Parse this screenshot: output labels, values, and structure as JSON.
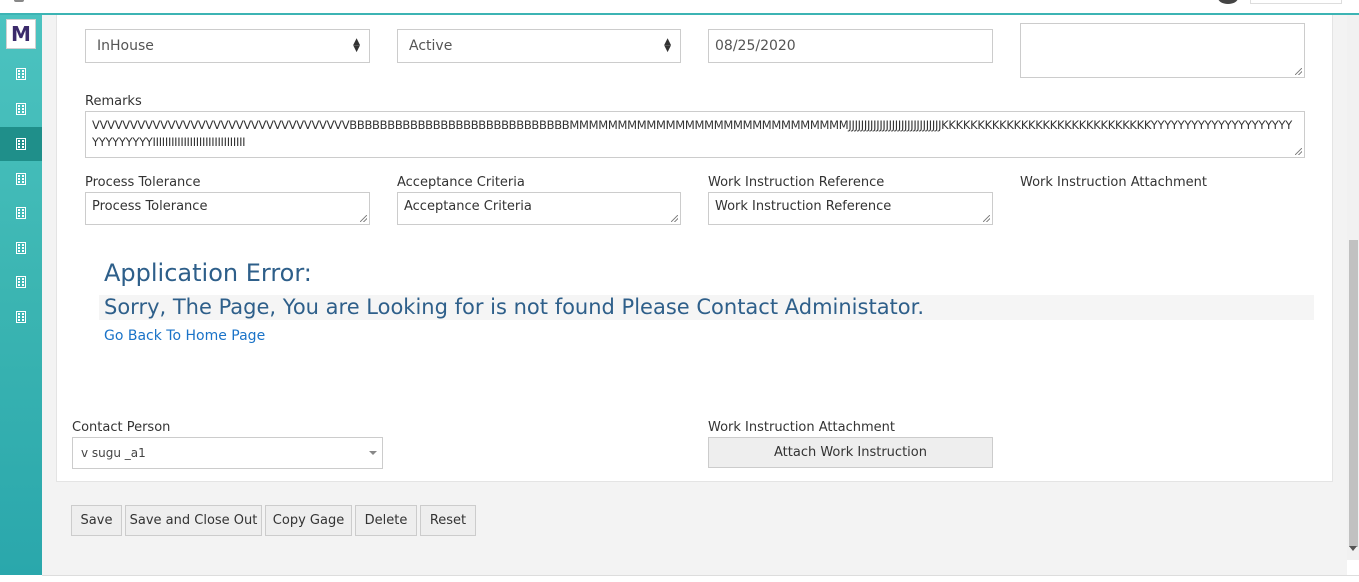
{
  "form": {
    "calibration_source": {
      "value": "InHouse"
    },
    "status": {
      "value": "Active"
    },
    "date_field": {
      "value": "08/25/2020"
    },
    "remarks": {
      "label": "Remarks",
      "value": "VVVVVVVVVVVVVVVVVVVVVVVVVVVVVVVVVVBBBBBBBBBBBBBBBBBBBBBBBBBBBBBMMMMMMMMMMMMMMMMMMMMMMMMMMMMMJJJJJJJJJJJJJJJJJJJJJJJJJJJJJJKKKKKKKKKKKKKKKKKKKKKKKKKKKKKYYYYYYYYYYYYYYYYYYYYYYYYYYYYYYIIIIIIIIIIIIIIIIIIIIIIIIIIIIII"
    },
    "process_tolerance": {
      "label": "Process Tolerance",
      "value": "Process Tolerance"
    },
    "acceptance_criteria": {
      "label": "Acceptance Criteria",
      "value": "Acceptance Criteria"
    },
    "work_instruction_reference": {
      "label": "Work Instruction Reference",
      "value": "Work Instruction Reference"
    },
    "work_instruction_attachment_top": {
      "label": "Work Instruction Attachment"
    },
    "contact_person": {
      "label": "Contact Person",
      "value": "v sugu _a1"
    },
    "work_instruction_attachment": {
      "label": "Work Instruction Attachment",
      "button": "Attach Work Instruction"
    }
  },
  "error": {
    "title": "Application Error:",
    "message": "Sorry, The Page, You are Looking for is not found Please Contact Administator.",
    "link": "Go Back To Home Page"
  },
  "actions": {
    "save": "Save",
    "save_close": "Save and Close Out",
    "copy": "Copy Gage",
    "delete": "Delete",
    "reset": "Reset"
  },
  "sidebar": {
    "logo": "M",
    "items": [
      {
        "icon": "building-icon",
        "active": false
      },
      {
        "icon": "building-icon",
        "active": false
      },
      {
        "icon": "building-icon",
        "active": true
      },
      {
        "icon": "building-icon",
        "active": false
      },
      {
        "icon": "building-icon",
        "active": false
      },
      {
        "icon": "building-icon",
        "active": false
      },
      {
        "icon": "building-icon",
        "active": false
      },
      {
        "icon": "building-icon",
        "active": false
      }
    ]
  },
  "colors": {
    "accent": "#3bb5b2",
    "active": "#1f8f8a",
    "error": "#2e5f8a",
    "link": "#1a73c8"
  }
}
